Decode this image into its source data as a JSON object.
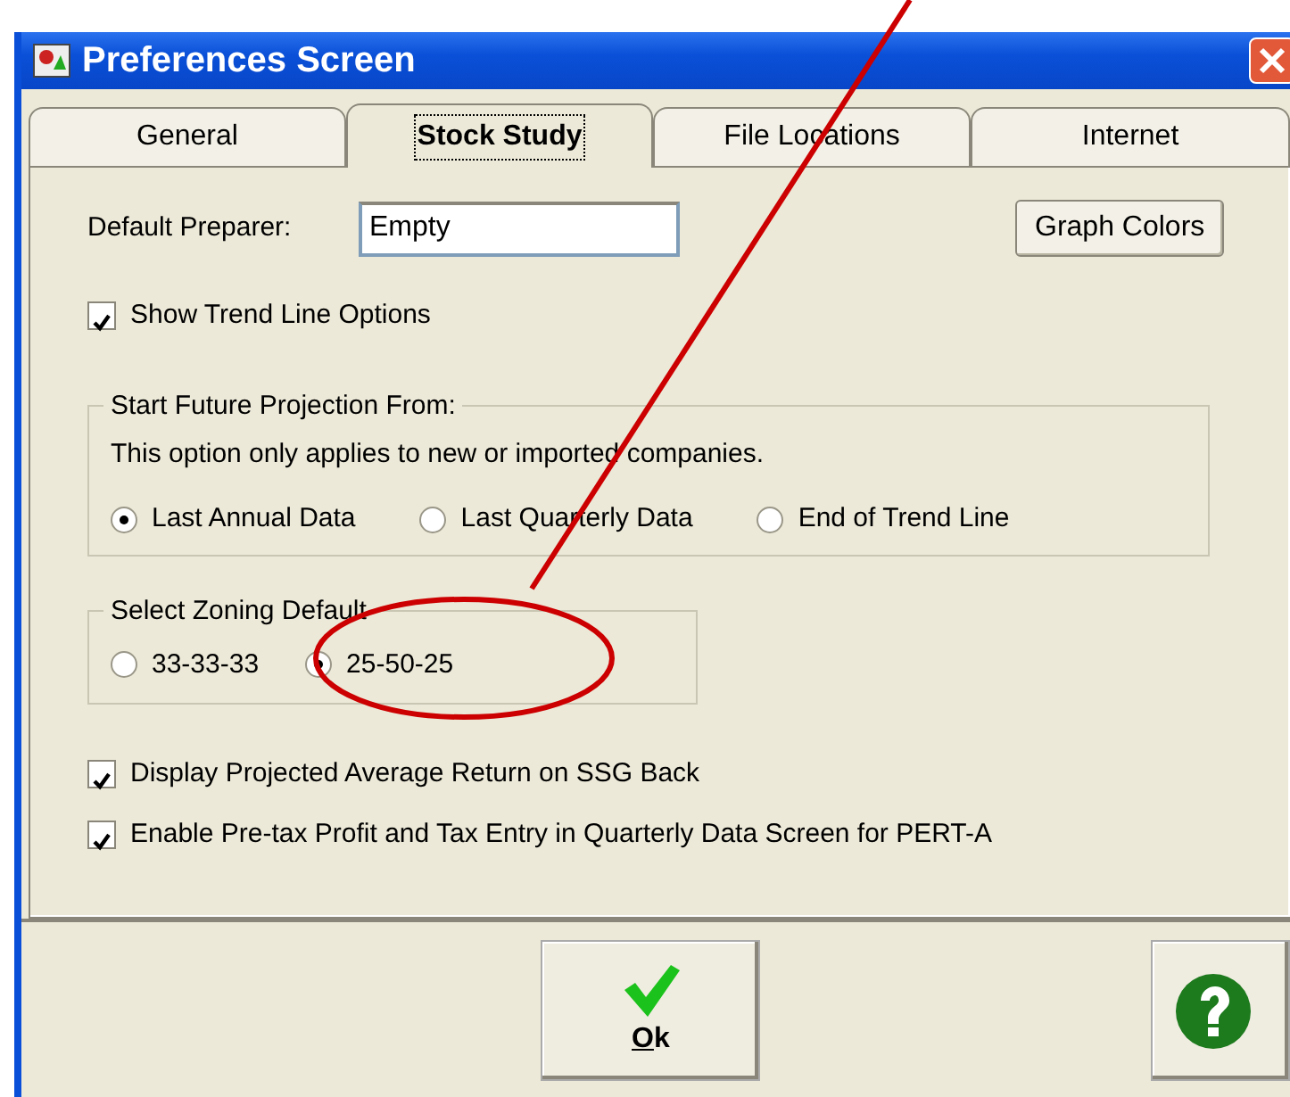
{
  "window": {
    "title": "Preferences Screen"
  },
  "tabs": [
    {
      "label": "General",
      "selected": false
    },
    {
      "label": "Stock Study",
      "selected": true
    },
    {
      "label": "File Locations",
      "selected": false
    },
    {
      "label": "Internet",
      "selected": false
    }
  ],
  "preparer": {
    "label": "Default Preparer:",
    "value": "Empty"
  },
  "graph_colors_button": "Graph Colors",
  "show_trend": {
    "label": "Show Trend Line Options",
    "checked": true
  },
  "projection_group": {
    "title": "Start Future Projection From:",
    "note": "This option only applies to new or imported companies.",
    "options": [
      {
        "label": "Last Annual Data",
        "selected": true
      },
      {
        "label": "Last Quarterly Data",
        "selected": false
      },
      {
        "label": "End of Trend Line",
        "selected": false
      }
    ]
  },
  "zoning_group": {
    "title": "Select Zoning Default",
    "options": [
      {
        "label": "33-33-33",
        "selected": false
      },
      {
        "label": "25-50-25",
        "selected": true
      }
    ]
  },
  "checkboxes": [
    {
      "label": "Display Projected Average Return on SSG Back",
      "checked": true
    },
    {
      "label": "Enable Pre-tax Profit and Tax Entry in Quarterly Data Screen for PERT-A",
      "checked": true
    }
  ],
  "ok_button": {
    "label": "Ok",
    "mnemonic_underlined": true
  }
}
